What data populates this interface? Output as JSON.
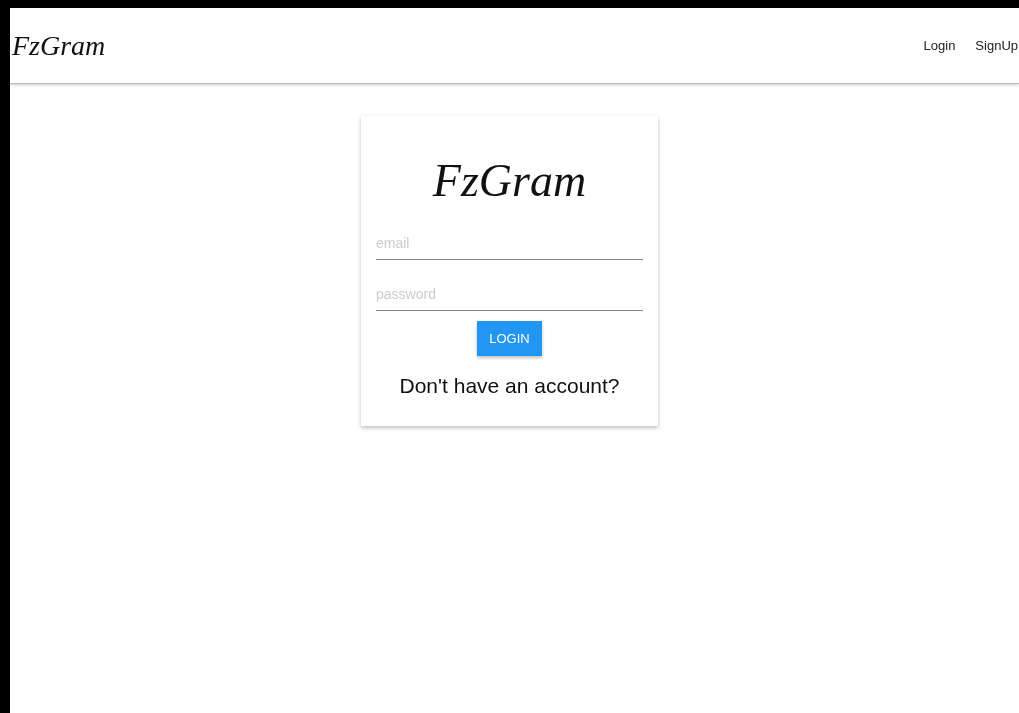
{
  "navbar": {
    "brand": "FzGram",
    "links": [
      {
        "label": "Login"
      },
      {
        "label": "SignUp"
      }
    ]
  },
  "card": {
    "brand": "FzGram",
    "fields": [
      {
        "placeholder": "email"
      },
      {
        "placeholder": "password"
      }
    ],
    "button": "LOGIN",
    "link": "Don't have an account?"
  }
}
